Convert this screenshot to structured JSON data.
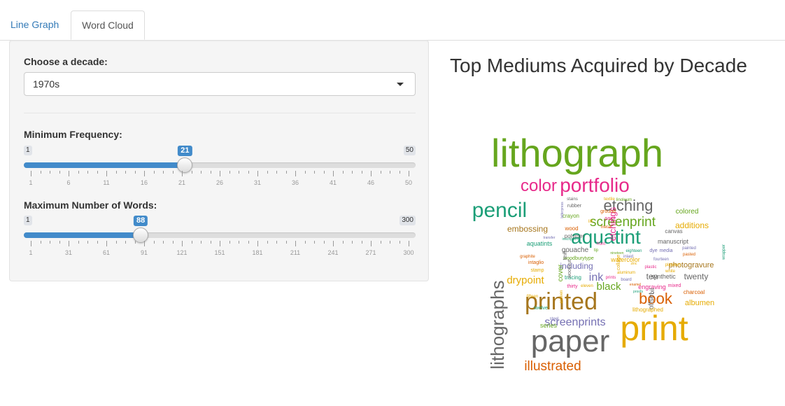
{
  "tabs": [
    {
      "label": "Line Graph",
      "active": false
    },
    {
      "label": "Word Cloud",
      "active": true
    }
  ],
  "controls": {
    "decade_label": "Choose a decade:",
    "decade_value": "1970s",
    "minfreq": {
      "label": "Minimum Frequency:",
      "min": "1",
      "max": "50",
      "value": "21",
      "ticks": [
        "1",
        "6",
        "11",
        "16",
        "21",
        "26",
        "31",
        "36",
        "41",
        "46",
        "50"
      ],
      "value_fraction": 0.4082
    },
    "maxwords": {
      "label": "Maximum Number of Words:",
      "min": "1",
      "max": "300",
      "value": "88",
      "ticks": [
        "1",
        "31",
        "61",
        "91",
        "121",
        "151",
        "181",
        "211",
        "241",
        "271",
        "300"
      ],
      "value_fraction": 0.291
    }
  },
  "cloud": {
    "title": "Top Mediums Acquired by Decade",
    "words": [
      {
        "t": "lithograph",
        "c": "#66a61e"
      },
      {
        "t": "print",
        "c": "#e6ab02"
      },
      {
        "t": "paper",
        "c": "#666666"
      },
      {
        "t": "printed",
        "c": "#a6761d"
      },
      {
        "t": "lithographs",
        "c": "#666666"
      },
      {
        "t": "portfolio",
        "c": "#e7298a"
      },
      {
        "t": "pencil",
        "c": "#1b9e77"
      },
      {
        "t": "aquatint",
        "c": "#1b9e77"
      },
      {
        "t": "color",
        "c": "#e7298a"
      },
      {
        "t": "etching",
        "c": "#666666"
      },
      {
        "t": "screenprint",
        "c": "#66a61e"
      },
      {
        "t": "book",
        "c": "#d95f02"
      },
      {
        "t": "illustrated",
        "c": "#d95f02"
      },
      {
        "t": "screenprints",
        "c": "#7570b3"
      },
      {
        "t": "drypoint",
        "c": "#e6ab02"
      },
      {
        "t": "black",
        "c": "#66a61e"
      },
      {
        "t": "ink",
        "c": "#7570b3"
      },
      {
        "t": "etchings",
        "c": "#e7298a"
      },
      {
        "t": "embossing",
        "c": "#a6761d"
      },
      {
        "t": "additions",
        "c": "#e6ab02"
      },
      {
        "t": "photogravure",
        "c": "#a6761d"
      },
      {
        "t": "twenty",
        "c": "#666666"
      },
      {
        "t": "including",
        "c": "#7570b3"
      },
      {
        "t": "albumen",
        "c": "#e6ab02"
      },
      {
        "t": "ten",
        "c": "#666666"
      },
      {
        "t": "colored",
        "c": "#66a61e"
      },
      {
        "t": "cover",
        "c": "#66a61e"
      },
      {
        "t": "gouache",
        "c": "#666666"
      },
      {
        "t": "aquatints",
        "c": "#1b9e77"
      },
      {
        "t": "synthetic",
        "c": "#666666"
      },
      {
        "t": "engraving",
        "c": "#e7298a"
      },
      {
        "t": "manuscript",
        "c": "#666666"
      },
      {
        "t": "watercolor",
        "c": "#e6ab02"
      },
      {
        "t": "offset",
        "c": "#666666"
      },
      {
        "t": "oil",
        "c": "#666666"
      },
      {
        "t": "series",
        "c": "#66a61e"
      },
      {
        "t": "canvas",
        "c": "#666666"
      },
      {
        "t": "crayon",
        "c": "#66a61e"
      },
      {
        "t": "polymer",
        "c": "#666666"
      },
      {
        "t": "woodburytype",
        "c": "#66a61e"
      },
      {
        "t": "tracing",
        "c": "#1b9e77"
      },
      {
        "t": "charcoal",
        "c": "#d95f02"
      },
      {
        "t": "lithographed",
        "c": "#e6ab02"
      },
      {
        "t": "wood",
        "c": "#d95f02"
      },
      {
        "t": "thirty",
        "c": "#e7298a"
      },
      {
        "t": "intaglio",
        "c": "#d95f02"
      },
      {
        "t": "stamp",
        "c": "#e6ab02"
      },
      {
        "t": "twelve",
        "c": "#1b9e77"
      },
      {
        "t": "mixed",
        "c": "#e7298a"
      },
      {
        "t": "rubber",
        "c": "#666666"
      },
      {
        "t": "stains",
        "c": "#666666"
      },
      {
        "t": "ground",
        "c": "#d95f02"
      },
      {
        "t": "paint",
        "c": "#e7298a"
      },
      {
        "t": "text",
        "c": "#666666"
      },
      {
        "t": "media",
        "c": "#7570b3"
      },
      {
        "t": "dye",
        "c": "#7570b3"
      },
      {
        "t": "eighteen",
        "c": "#1b9e77"
      },
      {
        "t": "fourteen",
        "c": "#7570b3"
      },
      {
        "t": "platinum",
        "c": "#e6ab02"
      },
      {
        "t": "plastic",
        "c": "#e7298a"
      },
      {
        "t": "white",
        "c": "#e6ab02"
      },
      {
        "t": "pasted",
        "c": "#d95f02"
      },
      {
        "t": "painted",
        "c": "#7570b3"
      },
      {
        "t": "graphite",
        "c": "#d95f02"
      },
      {
        "t": "fifteen",
        "c": "#e6ab02"
      },
      {
        "t": "steel",
        "c": "#7570b3"
      },
      {
        "t": "front",
        "c": "#e7298a"
      },
      {
        "t": "prints",
        "c": "#e7298a"
      },
      {
        "t": "board",
        "c": "#7570b3"
      },
      {
        "t": "aluminum",
        "c": "#e6ab02"
      },
      {
        "t": "metal",
        "c": "#d95f02"
      },
      {
        "t": "linoleum",
        "c": "#66a61e"
      },
      {
        "t": "textile",
        "c": "#e6ab02"
      },
      {
        "t": "transfer",
        "c": "#7570b3"
      },
      {
        "t": "woodcut",
        "c": "#666666"
      },
      {
        "t": "collage",
        "c": "#e6ab02"
      },
      {
        "t": "eleven",
        "c": "#e6ab02"
      },
      {
        "t": "sixteen",
        "c": "#e6ab02"
      },
      {
        "t": "tip",
        "c": "#66a61e"
      },
      {
        "t": "letterpress",
        "c": "#7570b3"
      },
      {
        "t": "inscriptions",
        "c": "#1b9e77"
      },
      {
        "t": "lift",
        "c": "#e6ab02"
      },
      {
        "t": "wrapper",
        "c": "#1b9e77"
      },
      {
        "t": "nineteen",
        "c": "#66a61e"
      },
      {
        "t": "inlaid",
        "c": "#7570b3"
      },
      {
        "t": "zinc",
        "c": "#e6ab02"
      },
      {
        "t": "enamel",
        "c": "#d95f02"
      },
      {
        "t": "proofs",
        "c": "#1b9e77"
      }
    ]
  }
}
